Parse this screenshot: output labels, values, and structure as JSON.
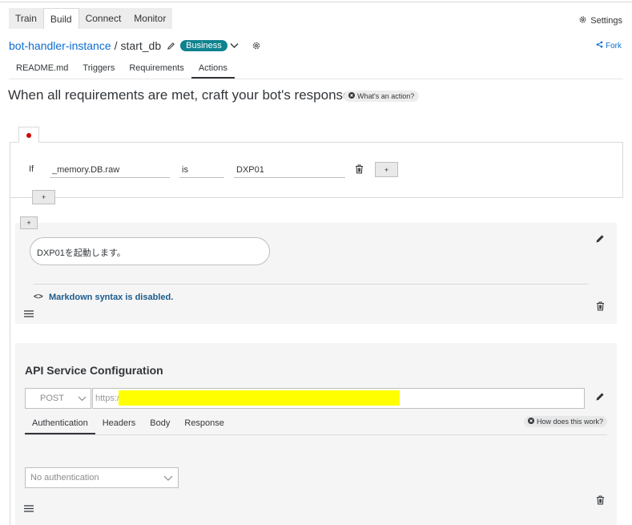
{
  "nav": {
    "tabs": [
      {
        "label": "Train"
      },
      {
        "label": "Build"
      },
      {
        "label": "Connect"
      },
      {
        "label": "Monitor"
      }
    ],
    "active_tab": "Build",
    "settings_label": "Settings"
  },
  "breadcrumb": {
    "bot": "bot-handler-instance",
    "separator": "/",
    "skill": "start_db",
    "badge": "Business",
    "fork_label": "Fork"
  },
  "subtabs": [
    {
      "label": "README.md"
    },
    {
      "label": "Triggers"
    },
    {
      "label": "Requirements"
    },
    {
      "label": "Actions"
    }
  ],
  "active_subtab": "Actions",
  "heading": "When all requirements are met, craft your bot's response",
  "whats_action": "What's an action?",
  "condition": {
    "if_label": "If",
    "variable": "_memory.DB.raw",
    "operator": "is",
    "value": "DXP01",
    "add_label": "+",
    "status_color": "#d00000"
  },
  "add_group_label": "+",
  "message": {
    "add_label": "+",
    "text": "DXP01を起動します。",
    "markdown_icon": "<>",
    "markdown_note": "Markdown syntax is disabled."
  },
  "api": {
    "title": "API Service Configuration",
    "method": "POST",
    "url_prefix": "https://",
    "tabs": [
      {
        "label": "Authentication"
      },
      {
        "label": "Headers"
      },
      {
        "label": "Body"
      },
      {
        "label": "Response"
      }
    ],
    "active_tab": "Authentication",
    "how_label": "How does this work?",
    "auth_value": "No authentication"
  },
  "colors": {
    "accent": "#0a6ed1",
    "badge": "#0f828f",
    "redaction": "#ffff00"
  },
  "icons": [
    "gear-icon",
    "pencil-icon",
    "chevron-down-icon",
    "fork-icon",
    "info-icon",
    "trash-icon",
    "drag-handle-icon",
    "code-icon"
  ]
}
